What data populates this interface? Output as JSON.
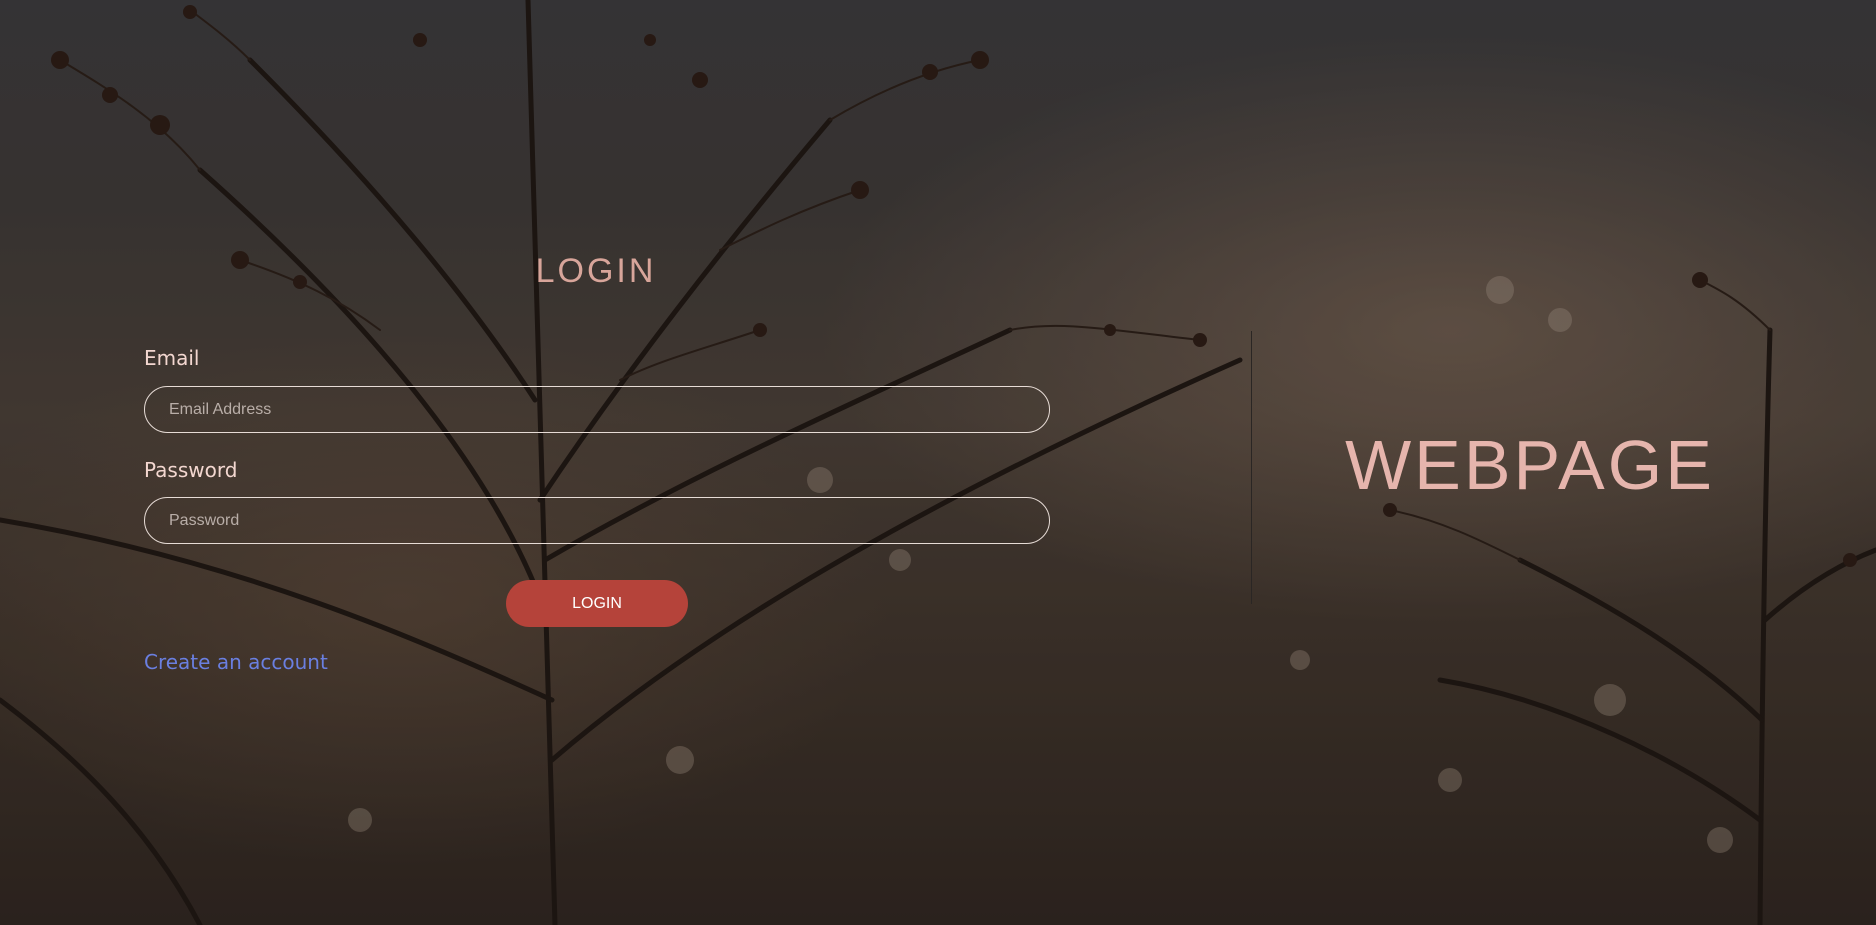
{
  "colors": {
    "title_accent": "#d8a59a",
    "brand_text": "#e6b5ad",
    "button_background": "#b5433a",
    "link": "#6a7fe0",
    "label_text": "#f3d7d0"
  },
  "login_form": {
    "title": "LOGIN",
    "email": {
      "label": "Email",
      "placeholder": "Email Address",
      "value": ""
    },
    "password": {
      "label": "Password",
      "placeholder": "Password",
      "value": ""
    },
    "submit_label": "LOGIN",
    "create_account_link": "Create an account"
  },
  "brand": {
    "text": "WEBPAGE"
  }
}
